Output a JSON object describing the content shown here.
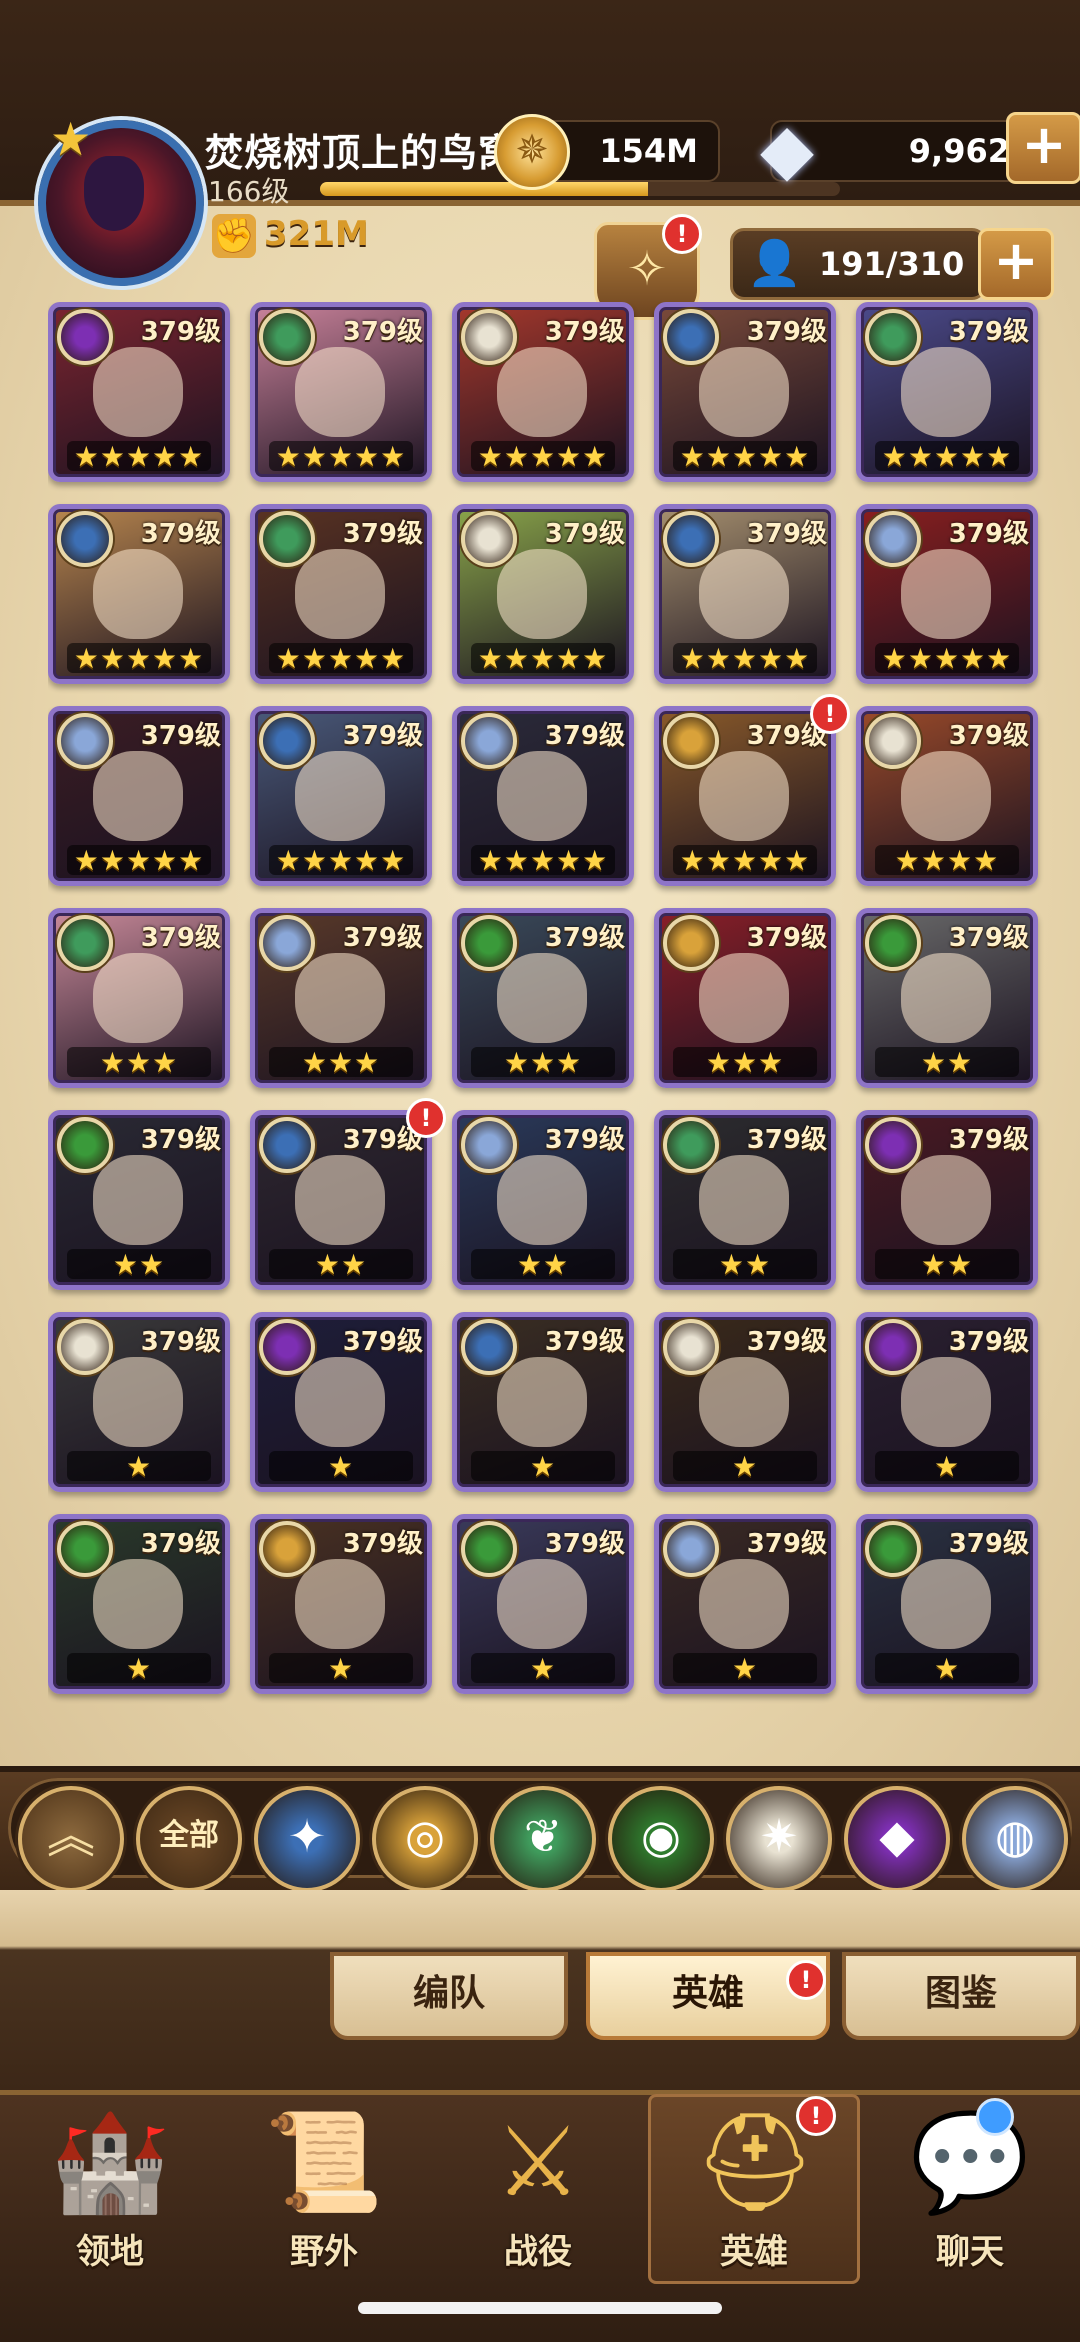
{
  "player": {
    "name": "焚烧树顶上的鸟窝",
    "level": "166级",
    "xp_fraction": 0.63,
    "power": "321M"
  },
  "currency": {
    "gold": "154M",
    "diamonds": "9,962",
    "plus": "+"
  },
  "hero_count": "191/310",
  "badges": {
    "alert": "!"
  },
  "factions": {
    "lightbearer": "#3c6fb5",
    "mauler": "#d9a23a",
    "wilder": "#3f9b5c",
    "graveborn": "#3a9a3a",
    "celestial": "#e8e2d2",
    "hypogean": "#7d2fb3",
    "dimensional": "#8aa7d8"
  },
  "heroes": [
    {
      "faction": "hypogean",
      "level": "379级",
      "stars": "★★★★★",
      "bg": "#7c2530"
    },
    {
      "faction": "wilder",
      "level": "379级",
      "stars": "★★★★★",
      "bg": "#c9829a"
    },
    {
      "faction": "celestial",
      "level": "379级",
      "stars": "★★★★★",
      "bg": "#a5382c"
    },
    {
      "faction": "lightbearer",
      "level": "379级",
      "stars": "★★★★★",
      "bg": "#7a4a3a"
    },
    {
      "faction": "wilder",
      "level": "379级",
      "stars": "★★★★★",
      "bg": "#4b4a8a"
    },
    {
      "faction": "lightbearer",
      "level": "379级",
      "stars": "★★★★★",
      "bg": "#b8864e"
    },
    {
      "faction": "wilder",
      "level": "379级",
      "stars": "★★★★★",
      "bg": "#5a3322"
    },
    {
      "faction": "celestial",
      "level": "379级",
      "stars": "★★★★★",
      "bg": "#8aa54a"
    },
    {
      "faction": "lightbearer",
      "level": "379级",
      "stars": "★★★★★",
      "bg": "#a58f6e"
    },
    {
      "faction": "dimensional",
      "level": "379级",
      "stars": "★★★★★",
      "bg": "#8a1f1f"
    },
    {
      "faction": "dimensional",
      "level": "379级",
      "stars": "★★★★★",
      "bg": "#3b1d24"
    },
    {
      "faction": "lightbearer",
      "level": "379级",
      "stars": "★★★★★",
      "bg": "#4a5a7a"
    },
    {
      "faction": "dimensional",
      "level": "379级",
      "stars": "★★★★★",
      "bg": "#2b2b3a"
    },
    {
      "faction": "mauler",
      "level": "379级",
      "stars": "★★★★★",
      "bg": "#8a5a2a",
      "alert": true
    },
    {
      "faction": "celestial",
      "level": "379级",
      "stars": "★★★★",
      "bg": "#9a4a2a"
    },
    {
      "faction": "wilder",
      "level": "379级",
      "stars": "★★★",
      "bg": "#c98a9a"
    },
    {
      "faction": "dimensional",
      "level": "379级",
      "stars": "★★★",
      "bg": "#5a3a2a"
    },
    {
      "faction": "graveborn",
      "level": "379级",
      "stars": "★★★",
      "bg": "#3a4a5a"
    },
    {
      "faction": "mauler",
      "level": "379级",
      "stars": "★★★",
      "bg": "#8a1f28"
    },
    {
      "faction": "graveborn",
      "level": "379级",
      "stars": "★★",
      "bg": "#6a6a6a"
    },
    {
      "faction": "graveborn",
      "level": "379级",
      "stars": "★★",
      "bg": "#2a2a34"
    },
    {
      "faction": "lightbearer",
      "level": "379级",
      "stars": "★★",
      "bg": "#2e2830",
      "alert": true
    },
    {
      "faction": "dimensional",
      "level": "379级",
      "stars": "★★",
      "bg": "#2a3a5a"
    },
    {
      "faction": "wilder",
      "level": "379级",
      "stars": "★★",
      "bg": "#2c2c2e"
    },
    {
      "faction": "hypogean",
      "level": "379级",
      "stars": "★★",
      "bg": "#4a1a22"
    },
    {
      "faction": "celestial",
      "level": "379级",
      "stars": "★",
      "bg": "#3a3a3a"
    },
    {
      "faction": "hypogean",
      "level": "379级",
      "stars": "★",
      "bg": "#1e1e3a"
    },
    {
      "faction": "lightbearer",
      "level": "379级",
      "stars": "★",
      "bg": "#3a2e22"
    },
    {
      "faction": "celestial",
      "level": "379级",
      "stars": "★",
      "bg": "#3a2a1a"
    },
    {
      "faction": "hypogean",
      "level": "379级",
      "stars": "★",
      "bg": "#2a2030"
    },
    {
      "faction": "graveborn",
      "level": "379级",
      "stars": "★",
      "bg": "#2a3a2a"
    },
    {
      "faction": "mauler",
      "level": "379级",
      "stars": "★",
      "bg": "#4a3222"
    },
    {
      "faction": "graveborn",
      "level": "379级",
      "stars": "★",
      "bg": "#3a3a5a"
    },
    {
      "faction": "dimensional",
      "level": "379级",
      "stars": "★",
      "bg": "#3a2a24"
    },
    {
      "faction": "graveborn",
      "level": "379级",
      "stars": "★",
      "bg": "#2a3242"
    }
  ],
  "filters": {
    "all_label": "全部",
    "collapse_icon": "double-chevron-up-icon",
    "items": [
      {
        "name": "lightbearer-faction-icon",
        "glyph": "✦",
        "color": "#3c6fb5"
      },
      {
        "name": "mauler-faction-icon",
        "glyph": "◎",
        "color": "#d9a23a"
      },
      {
        "name": "wilder-faction-icon",
        "glyph": "❦",
        "color": "#3f9b5c"
      },
      {
        "name": "graveborn-faction-icon",
        "glyph": "◉",
        "color": "#2f7d2f"
      },
      {
        "name": "celestial-faction-icon",
        "glyph": "✷",
        "color": "#e8e2d2"
      },
      {
        "name": "hypogean-faction-icon",
        "glyph": "◆",
        "color": "#7d2fb3"
      },
      {
        "name": "dimensional-faction-icon",
        "glyph": "◍",
        "color": "#8aa7d8"
      }
    ]
  },
  "subtabs": [
    "编队",
    "英雄",
    "图鉴"
  ],
  "nav": [
    "领地",
    "野外",
    "战役",
    "英雄",
    "聊天"
  ]
}
